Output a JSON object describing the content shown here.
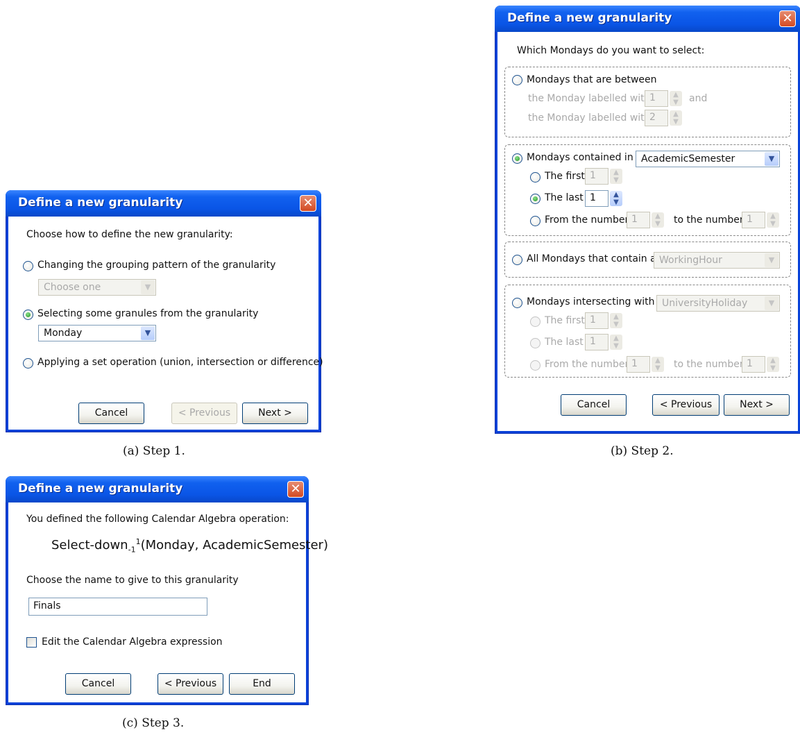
{
  "dialog_title": "Define a new granularity",
  "close_glyph": "✕",
  "step1": {
    "prompt": "Choose how to define the new granularity:",
    "option_grouping": "Changing the grouping pattern of the granularity",
    "grouping_combo": "Choose one",
    "option_selecting": "Selecting some granules from the granularity",
    "selecting_combo": "Monday",
    "option_setop": "Applying a set operation (union, intersection or difference)",
    "cancel": "Cancel",
    "previous": "< Previous",
    "next": "Next >",
    "caption": "(a) Step 1."
  },
  "step2": {
    "prompt": "Which Mondays do you want to select:",
    "between_label": "Mondays that are between",
    "labelled_with": "the Monday labelled with",
    "between_from": "1",
    "and": "and",
    "between_to": "2",
    "contained_label": "Mondays contained in a",
    "contained_combo": "AcademicSemester",
    "the_first": "The first",
    "first_value": "1",
    "the_last": "The last",
    "last_value": "1",
    "from_number": "From the number",
    "from_value": "1",
    "to_number": "to the number",
    "to_value": "1",
    "contain_label": "All Mondays that contain a",
    "contain_combo": "WorkingHour",
    "intersect_label": "Mondays intersecting with a",
    "intersect_combo": "UniversityHoliday",
    "i_first_value": "1",
    "i_last_value": "1",
    "i_from_value": "1",
    "i_to_value": "1",
    "cancel": "Cancel",
    "previous": "< Previous",
    "next": "Next >",
    "caption": "(b) Step 2."
  },
  "step3": {
    "prompt": "You defined the following Calendar Algebra operation:",
    "formula_name": "Select-down",
    "formula_sub": "-1",
    "formula_sup": "1",
    "formula_args": "(Monday, AcademicSemester)",
    "name_prompt": "Choose the name to give to this granularity",
    "name_value": "Finals",
    "edit_label": "Edit the Calendar Algebra expression",
    "cancel": "Cancel",
    "previous": "< Previous",
    "end": "End",
    "caption": "(c) Step 3."
  }
}
